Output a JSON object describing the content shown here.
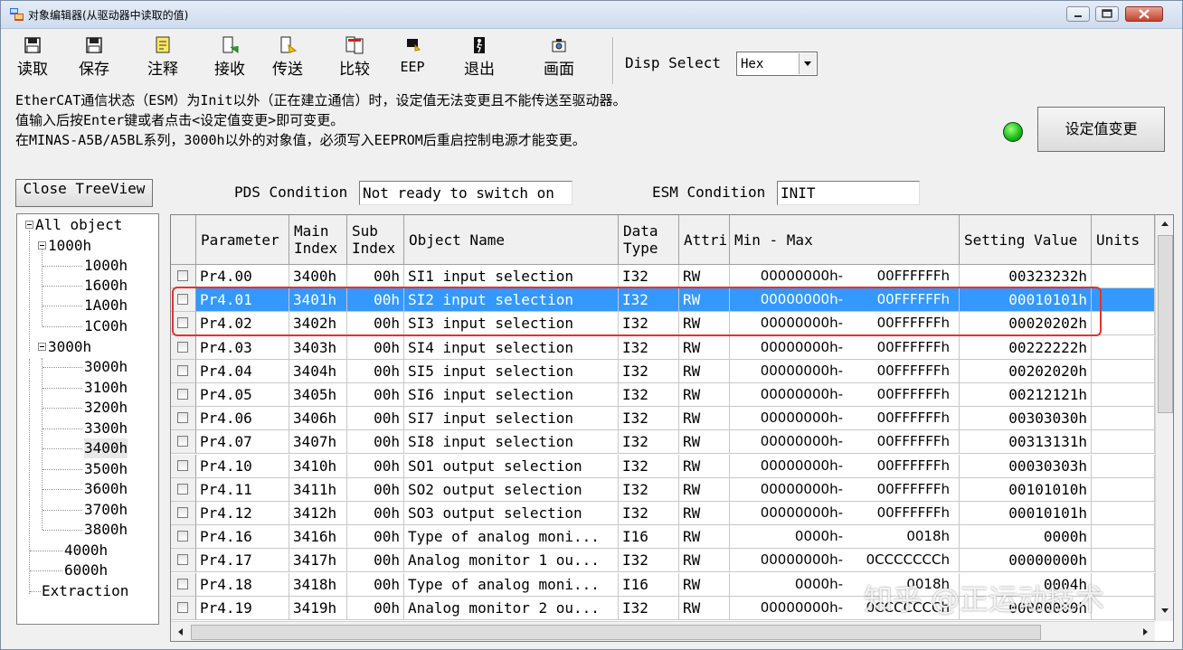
{
  "window": {
    "title": "对象编辑器(从驱动器中读取的值)"
  },
  "toolbar": {
    "buttons": [
      {
        "label": "读取",
        "icon": "floppy-disk-read-icon"
      },
      {
        "label": "保存",
        "icon": "floppy-disk-save-icon"
      },
      {
        "label": "注释",
        "icon": "note-icon"
      },
      {
        "label": "接收",
        "icon": "receive-icon"
      },
      {
        "label": "传送",
        "icon": "send-icon"
      },
      {
        "label": "比较",
        "icon": "compare-icon"
      },
      {
        "label": "EEP",
        "icon": "eeprom-icon"
      },
      {
        "label": "退出",
        "icon": "exit-icon"
      },
      {
        "label": "画面",
        "icon": "screen-icon"
      }
    ],
    "disp_select_label": "Disp Select",
    "disp_select_value": "Hex"
  },
  "notice": {
    "line1": "EtherCAT通信状态（ESM）为Init以外（正在建立通信）时，设定值无法变更且不能传送至驱动器。",
    "line2": "值输入后按Enter键或者点击<设定值变更>即可变更。",
    "line3": "在MINAS-A5B/A5BL系列，3000h以外的对象值，必须写入EEPROM后重启控制电源才能变更。"
  },
  "status_led_color": "#1fbf1f",
  "set_value_button": "设定值变更",
  "close_treeview_button": "Close TreeView",
  "pds": {
    "label": "PDS Condition",
    "value": "Not ready to switch on"
  },
  "esm": {
    "label": "ESM Condition",
    "value": "INIT"
  },
  "tree": {
    "root": "All object",
    "nodes": [
      {
        "label": "1000h",
        "children": [
          "1000h",
          "1600h",
          "1A00h",
          "1C00h"
        ]
      },
      {
        "label": "3000h",
        "children": [
          "3000h",
          "3100h",
          "3200h",
          "3300h",
          "3400h",
          "3500h",
          "3600h",
          "3700h",
          "3800h"
        ]
      }
    ],
    "leaf_nodes": [
      "4000h",
      "6000h"
    ],
    "extraction": "Extraction",
    "selected": "3400h"
  },
  "table": {
    "headers": [
      "Parameter",
      "Main\nIndex",
      "Sub\nIndex",
      "Object Name",
      "Data\nType",
      "Attri",
      "Min - Max",
      "Setting Value",
      "Units"
    ],
    "selected_row": 1,
    "highlighted_rows": [
      1,
      2
    ],
    "rows": [
      {
        "param": "Pr4.00",
        "main": "3400h",
        "sub": "00h",
        "name": "SI1 input selection",
        "type": "I32",
        "attr": "RW",
        "min": "00000000h-",
        "max": "00FFFFFFh",
        "value": "00323232h"
      },
      {
        "param": "Pr4.01",
        "main": "3401h",
        "sub": "00h",
        "name": "SI2 input selection",
        "type": "I32",
        "attr": "RW",
        "min": "00000000h-",
        "max": "00FFFFFFh",
        "value": "00010101h"
      },
      {
        "param": "Pr4.02",
        "main": "3402h",
        "sub": "00h",
        "name": "SI3 input selection",
        "type": "I32",
        "attr": "RW",
        "min": "00000000h-",
        "max": "00FFFFFFh",
        "value": "00020202h"
      },
      {
        "param": "Pr4.03",
        "main": "3403h",
        "sub": "00h",
        "name": "SI4 input selection",
        "type": "I32",
        "attr": "RW",
        "min": "00000000h-",
        "max": "00FFFFFFh",
        "value": "00222222h"
      },
      {
        "param": "Pr4.04",
        "main": "3404h",
        "sub": "00h",
        "name": "SI5 input selection",
        "type": "I32",
        "attr": "RW",
        "min": "00000000h-",
        "max": "00FFFFFFh",
        "value": "00202020h"
      },
      {
        "param": "Pr4.05",
        "main": "3405h",
        "sub": "00h",
        "name": "SI6 input selection",
        "type": "I32",
        "attr": "RW",
        "min": "00000000h-",
        "max": "00FFFFFFh",
        "value": "00212121h"
      },
      {
        "param": "Pr4.06",
        "main": "3406h",
        "sub": "00h",
        "name": "SI7 input selection",
        "type": "I32",
        "attr": "RW",
        "min": "00000000h-",
        "max": "00FFFFFFh",
        "value": "00303030h"
      },
      {
        "param": "Pr4.07",
        "main": "3407h",
        "sub": "00h",
        "name": "SI8 input selection",
        "type": "I32",
        "attr": "RW",
        "min": "00000000h-",
        "max": "00FFFFFFh",
        "value": "00313131h"
      },
      {
        "param": "Pr4.10",
        "main": "3410h",
        "sub": "00h",
        "name": "SO1 output selection",
        "type": "I32",
        "attr": "RW",
        "min": "00000000h-",
        "max": "00FFFFFFh",
        "value": "00030303h"
      },
      {
        "param": "Pr4.11",
        "main": "3411h",
        "sub": "00h",
        "name": "SO2 output selection",
        "type": "I32",
        "attr": "RW",
        "min": "00000000h-",
        "max": "00FFFFFFh",
        "value": "00101010h"
      },
      {
        "param": "Pr4.12",
        "main": "3412h",
        "sub": "00h",
        "name": "SO3 output selection",
        "type": "I32",
        "attr": "RW",
        "min": "00000000h-",
        "max": "00FFFFFFh",
        "value": "00010101h"
      },
      {
        "param": "Pr4.16",
        "main": "3416h",
        "sub": "00h",
        "name": "Type of analog moni...",
        "type": "I16",
        "attr": "RW",
        "min": "0000h-",
        "max": "0018h",
        "value": "0000h"
      },
      {
        "param": "Pr4.17",
        "main": "3417h",
        "sub": "00h",
        "name": "Analog monitor 1 ou...",
        "type": "I32",
        "attr": "RW",
        "min": "00000000h-",
        "max": "0CCCCCCCh",
        "value": "00000000h"
      },
      {
        "param": "Pr4.18",
        "main": "3418h",
        "sub": "00h",
        "name": "Type of analog moni...",
        "type": "I16",
        "attr": "RW",
        "min": "0000h-",
        "max": "0018h",
        "value": "0004h"
      },
      {
        "param": "Pr4.19",
        "main": "3419h",
        "sub": "00h",
        "name": "Analog monitor 2 ou...",
        "type": "I32",
        "attr": "RW",
        "min": "00000000h-",
        "max": "0CCCCCCCh",
        "value": "00000000h"
      }
    ]
  },
  "watermark": "知乎 @正运动技术"
}
